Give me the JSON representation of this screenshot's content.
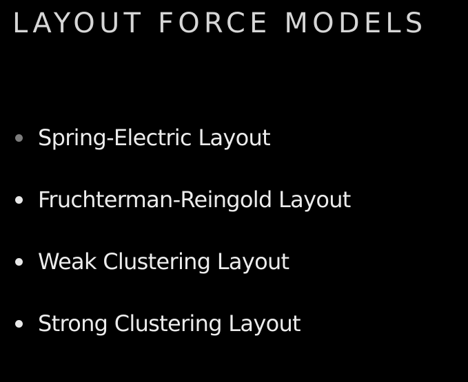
{
  "slide": {
    "title": "LAYOUT FORCE MODELS",
    "background_color": "#000000",
    "title_color": "#d6d6d6",
    "bullet_text_color": "#ececec",
    "bullets": [
      {
        "label": "Spring-Electric Layout",
        "bullet_color": "#7c7c7c"
      },
      {
        "label": "Fruchterman-Reingold Layout",
        "bullet_color": "#e8e8e8"
      },
      {
        "label": "Weak Clustering Layout",
        "bullet_color": "#e8e8e8"
      },
      {
        "label": "Strong Clustering Layout",
        "bullet_color": "#e8e8e8"
      }
    ]
  }
}
